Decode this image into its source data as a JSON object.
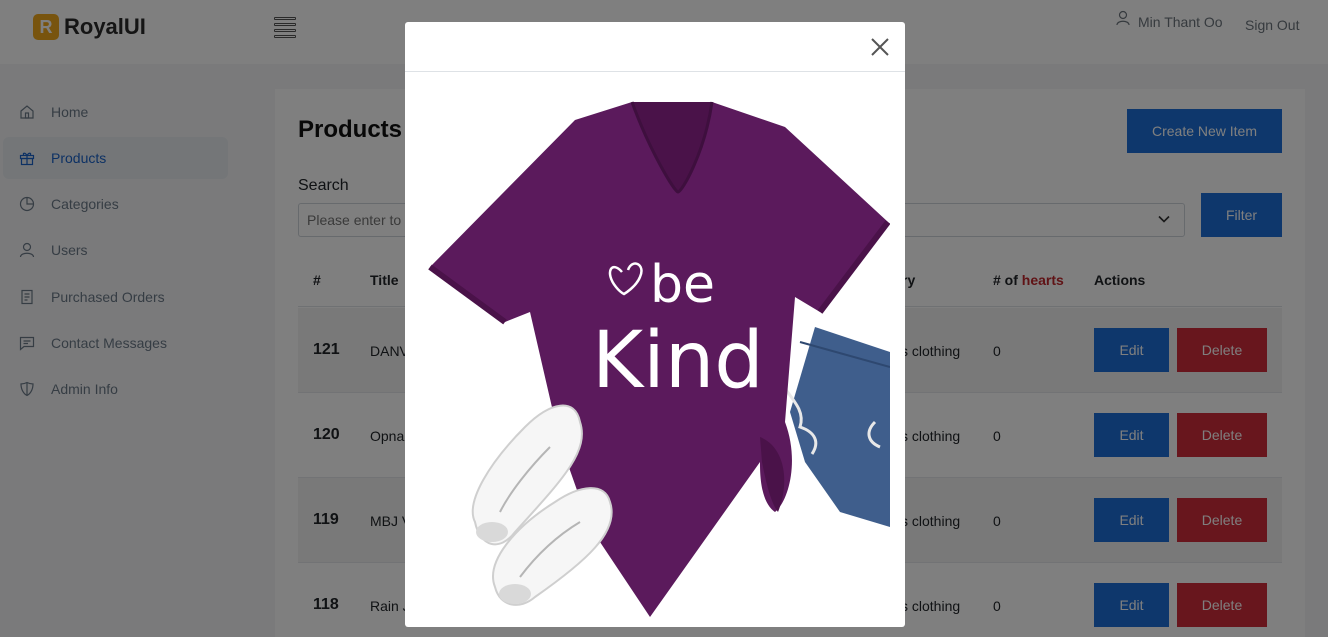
{
  "brand": {
    "mark": "R",
    "name": "RoyalUI"
  },
  "header": {
    "user_name": "Min Thant Oo",
    "sign_out": "Sign Out"
  },
  "sidebar": {
    "items": [
      {
        "label": "Home",
        "icon": "home-icon"
      },
      {
        "label": "Products",
        "icon": "gift-icon",
        "active": true
      },
      {
        "label": "Categories",
        "icon": "pie-chart-icon"
      },
      {
        "label": "Users",
        "icon": "user-icon"
      },
      {
        "label": "Purchased Orders",
        "icon": "document-icon"
      },
      {
        "label": "Contact Messages",
        "icon": "message-icon"
      },
      {
        "label": "Admin Info",
        "icon": "shield-icon"
      }
    ]
  },
  "main": {
    "title": "Products",
    "create_button": "Create New Item",
    "search_label": "Search",
    "search_placeholder": "Please enter to",
    "filter_button": "Filter",
    "columns": {
      "id": "#",
      "title": "Title",
      "category": "ry",
      "hearts_prefix": "# of ",
      "hearts_word": "hearts",
      "actions": "Actions"
    },
    "rows": [
      {
        "id": "121",
        "title": "DANV",
        "category": "s clothing",
        "hearts": "0",
        "edit": "Edit",
        "delete": "Delete"
      },
      {
        "id": "120",
        "title": "Opna",
        "category": "s clothing",
        "hearts": "0",
        "edit": "Edit",
        "delete": "Delete"
      },
      {
        "id": "119",
        "title": "MBJ V",
        "category": "s clothing",
        "hearts": "0",
        "edit": "Edit",
        "delete": "Delete"
      },
      {
        "id": "118",
        "title": "Rain J",
        "category": "s clothing",
        "hearts": "0",
        "edit": "Edit",
        "delete": "Delete"
      }
    ]
  },
  "modal": {
    "image_text_line1": "be",
    "image_text_line2": "Kind"
  },
  "colors": {
    "primary": "#1c6ed8",
    "danger": "#d12c3a",
    "brand": "#f0a81c",
    "shirt": "#5b1a5c",
    "denim": "#3d5a86",
    "hearts_accent": "#c0272d"
  }
}
